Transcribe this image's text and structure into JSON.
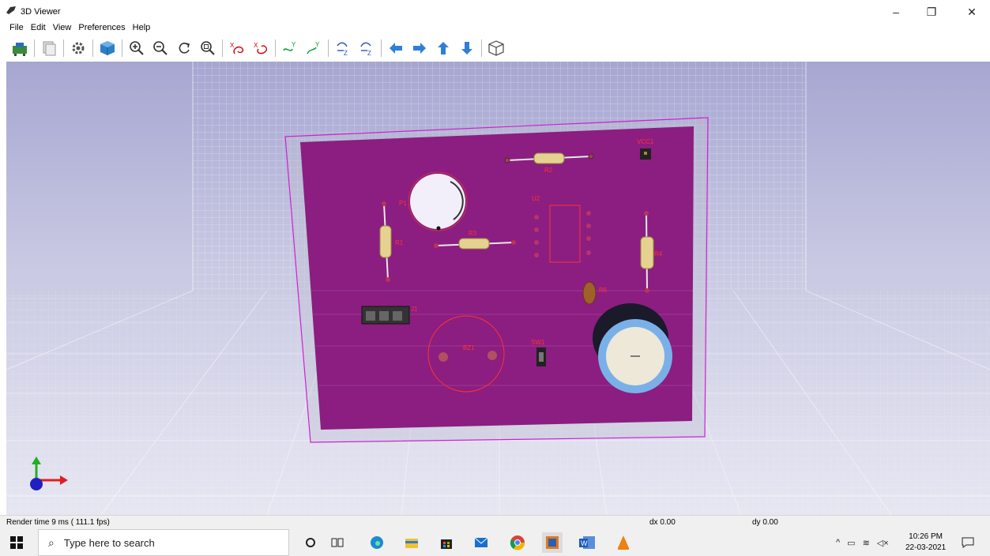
{
  "window": {
    "title": "3D Viewer",
    "minimize": "–",
    "maximize": "❐",
    "close": "✕"
  },
  "menu": [
    "File",
    "Edit",
    "View",
    "Preferences",
    "Help"
  ],
  "toolbar_icons": [
    "reload-board-icon",
    "copy-image-icon",
    "settings-icon",
    "raytrace-icon",
    "zoom-in-icon",
    "zoom-out-icon",
    "redraw-icon",
    "zoom-fit-icon",
    "rotate-x-cw-icon",
    "rotate-x-ccw-icon",
    "rotate-y-cw-icon",
    "rotate-y-ccw-icon",
    "rotate-z-cw-icon",
    "rotate-z-ccw-icon",
    "pan-left-icon",
    "pan-right-icon",
    "pan-up-icon",
    "pan-down-icon",
    "ortho-toggle-icon"
  ],
  "board": {
    "color": "#8b1e80",
    "labels": {
      "r2": "R2",
      "vcc1": "VCC1",
      "u2": "U2",
      "r1": "R1",
      "r3": "R3",
      "r4": "R4",
      "p1": "P1",
      "c1": "C1",
      "j1": "J1",
      "sw1": "SW1",
      "ldr": "R5"
    }
  },
  "status": {
    "render_time": "Render time 9 ms ( 111.1 fps)",
    "dx": "dx 0.00",
    "dy": "dy 0.00"
  },
  "taskbar": {
    "search_placeholder": "Type here to search",
    "time": "10:26 PM",
    "date": "22-03-2021"
  }
}
